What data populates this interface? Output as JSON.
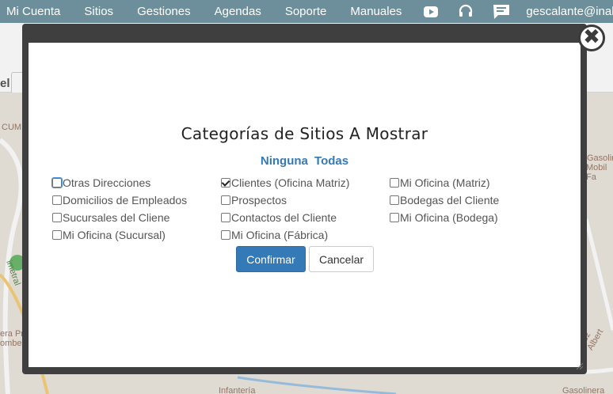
{
  "nav": {
    "items": [
      "Mi Cuenta",
      "Sitios",
      "Gestiones",
      "Agendas",
      "Soporte",
      "Manuales"
    ],
    "icons": [
      "youtube-icon",
      "headset-icon",
      "chat-icon"
    ],
    "user": "gescalante@inalar"
  },
  "background": {
    "field_label": "el",
    "map_labels": [
      "CUM",
      "Gasolin",
      "Mobil Fa",
      "imetral",
      "era Pri",
      "ombe",
      "Infantería",
      "Gasolinera",
      "Itez Albert"
    ]
  },
  "modal": {
    "title": "Categorías de Sitios A Mostrar",
    "link_none": "Ninguna",
    "link_all": "Todas",
    "columns": [
      [
        {
          "label": "Otras Direcciones",
          "checked": false
        },
        {
          "label": "Domicilios de Empleados",
          "checked": false
        },
        {
          "label": "Sucursales del Cliene",
          "checked": false
        },
        {
          "label": "Mi Oficina (Sucursal)",
          "checked": false
        }
      ],
      [
        {
          "label": "Clientes (Oficina Matriz)",
          "checked": true
        },
        {
          "label": "Prospectos",
          "checked": false
        },
        {
          "label": "Contactos del Cliente",
          "checked": false
        },
        {
          "label": "Mi Oficina (Fábrica)",
          "checked": false
        }
      ],
      [
        {
          "label": "Mi Oficina (Matriz)",
          "checked": false
        },
        {
          "label": "Bodegas del Cliente",
          "checked": false
        },
        {
          "label": "Mi Oficina (Bodega)",
          "checked": false
        }
      ]
    ],
    "confirm_label": "Confirmar",
    "cancel_label": "Cancelar",
    "close_symbol": "✖"
  },
  "colors": {
    "navbar": "#6d8f9b",
    "primary": "#337ab7",
    "modal_border": "#3f3f3f"
  }
}
